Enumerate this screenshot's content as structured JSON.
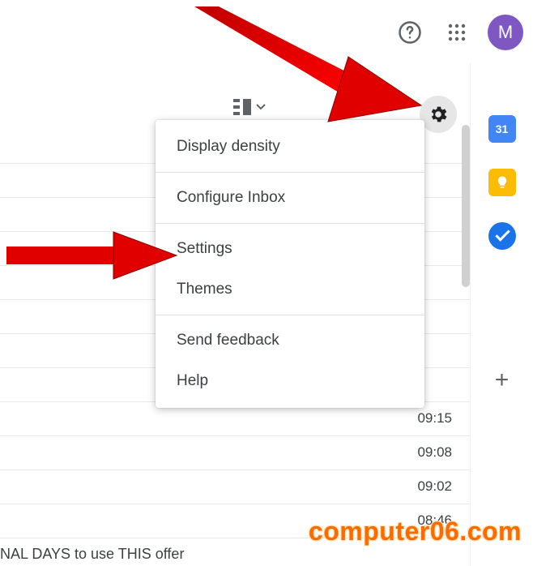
{
  "header": {
    "avatar_initial": "M"
  },
  "menu": {
    "items": [
      "Display density",
      "Configure Inbox",
      "Settings",
      "Themes",
      "Send feedback",
      "Help"
    ]
  },
  "side_panel": {
    "calendar_day": "31"
  },
  "mail": {
    "times": [
      "09:15",
      "09:08",
      "09:02",
      "08:46"
    ],
    "partial_row_text": "NAL DAYS to use THIS offer"
  },
  "watermark": "computer06.com"
}
